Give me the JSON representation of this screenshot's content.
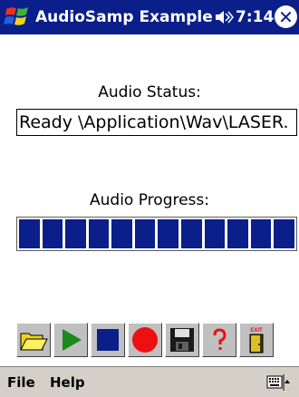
{
  "titlebar": {
    "title": "AudioSamp Example",
    "time": "7:14",
    "close_glyph": "✕",
    "bg_color": "#0a1f8a",
    "icons": [
      "windows-start-icon",
      "speaker-icon",
      "close-icon"
    ]
  },
  "audio_status": {
    "label": "Audio Status:",
    "value": "Ready \\Application\\Wav\\LASER."
  },
  "audio_progress": {
    "label": "Audio Progress:",
    "segments_filled": 12,
    "fill_fraction": 1.0,
    "fill_color": "#0a1f8a"
  },
  "toolbar": {
    "buttons": [
      {
        "name": "open-button",
        "icon": "folder-open-icon"
      },
      {
        "name": "play-button",
        "icon": "play-icon"
      },
      {
        "name": "stop-button",
        "icon": "stop-icon"
      },
      {
        "name": "record-button",
        "icon": "record-icon"
      },
      {
        "name": "save-button",
        "icon": "floppy-disk-icon"
      },
      {
        "name": "help-button",
        "icon": "question-mark-icon"
      },
      {
        "name": "exit-button",
        "icon": "exit-door-icon",
        "text": "EXIT"
      }
    ]
  },
  "menubar": {
    "file_label": "File",
    "help_label": "Help",
    "icons": [
      "keyboard-icon",
      "up-arrow-icon"
    ]
  }
}
